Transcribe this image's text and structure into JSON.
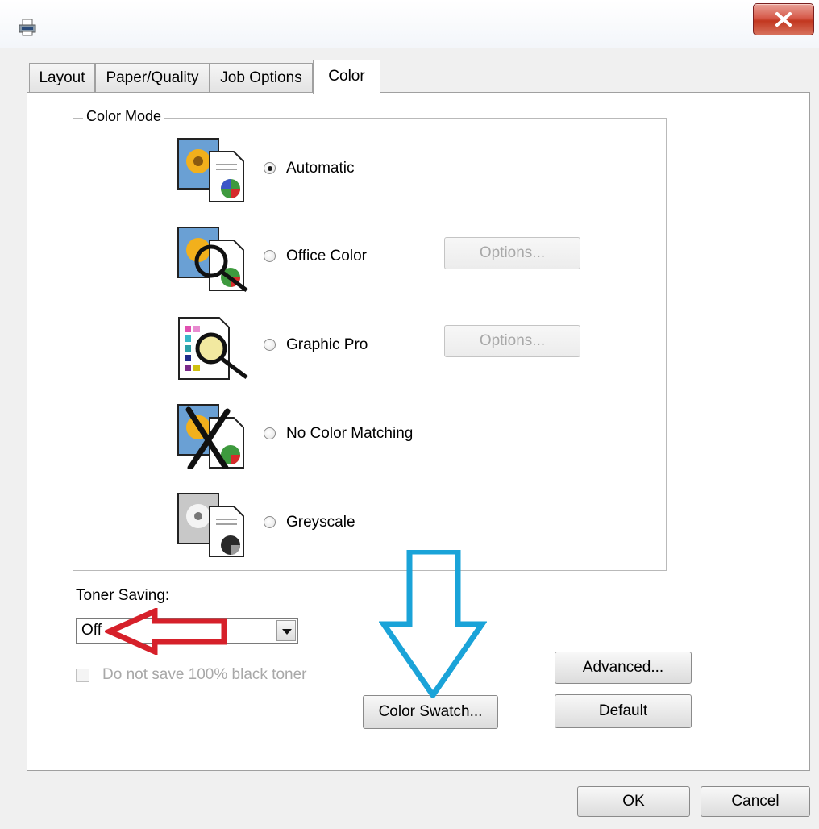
{
  "tabs": [
    {
      "label": "Layout"
    },
    {
      "label": "Paper/Quality"
    },
    {
      "label": "Job Options"
    },
    {
      "label": "Color",
      "active": true
    }
  ],
  "color_mode": {
    "legend": "Color Mode",
    "options": [
      {
        "label": "Automatic",
        "selected": true,
        "icon": "automatic-color-icon"
      },
      {
        "label": "Office Color",
        "selected": false,
        "icon": "office-color-icon",
        "options_button": "Options..."
      },
      {
        "label": "Graphic Pro",
        "selected": false,
        "icon": "graphic-pro-icon",
        "options_button": "Options..."
      },
      {
        "label": "No Color Matching",
        "selected": false,
        "icon": "no-color-matching-icon"
      },
      {
        "label": "Greyscale",
        "selected": false,
        "icon": "greyscale-icon"
      }
    ]
  },
  "toner_saving": {
    "label": "Toner Saving:",
    "value": "Off",
    "checkbox_label": "Do not save 100% black toner",
    "checkbox_checked": false
  },
  "buttons": {
    "advanced": "Advanced...",
    "default": "Default",
    "color_swatch": "Color Swatch...",
    "ok": "OK",
    "cancel": "Cancel"
  },
  "annotations": {
    "red_arrow_color": "#d6202a",
    "blue_arrow_color": "#1aa3d8"
  },
  "close_button_color": "#c9432f"
}
